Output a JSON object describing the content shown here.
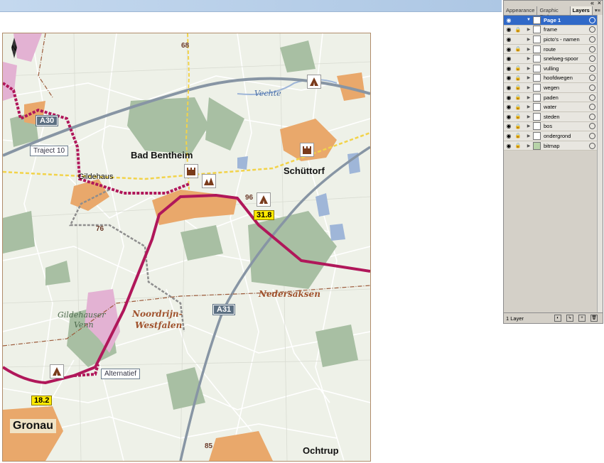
{
  "map": {
    "towns": {
      "bad_bentheim": "Bad Bentheim",
      "schuttorf": "Schüttorf",
      "gildehaus": "Gildehaus",
      "gronau": "Gronau",
      "ochtrup": "Ochtrup"
    },
    "roads": {
      "a30": "A30",
      "a31": "A31"
    },
    "traject": "Traject 10",
    "alternatief": "Alternatief",
    "km_markers": [
      "31.8",
      "18.2"
    ],
    "numbers": [
      "68",
      "96",
      "76",
      "85"
    ],
    "regions": [
      "Nedersaksen",
      "Noordrijn-",
      "Westfalen"
    ],
    "nature": [
      "Gildehauser",
      "Venn"
    ],
    "water": "Vechte",
    "north": "N",
    "colors": {
      "route": "#b0175a",
      "forest": "#a8bfa3",
      "town": "#e9a86b",
      "water": "#9fb6d8",
      "motorway": "#5b6f82"
    }
  },
  "panel": {
    "tabs": [
      "Appearance",
      "Graphic Styles",
      "Layers"
    ],
    "active_tab": "Layers",
    "layers": [
      {
        "name": "Page 1",
        "selected": true
      },
      {
        "name": "frame"
      },
      {
        "name": "picto's - namen"
      },
      {
        "name": "route"
      },
      {
        "name": "snelweg-spoor"
      },
      {
        "name": "vulling"
      },
      {
        "name": "hoofdwegen"
      },
      {
        "name": "wegen"
      },
      {
        "name": "paden"
      },
      {
        "name": "water"
      },
      {
        "name": "steden"
      },
      {
        "name": "bos"
      },
      {
        "name": "ondergrond"
      },
      {
        "name": "bitmap"
      }
    ],
    "layer_count": "1 Layer"
  }
}
